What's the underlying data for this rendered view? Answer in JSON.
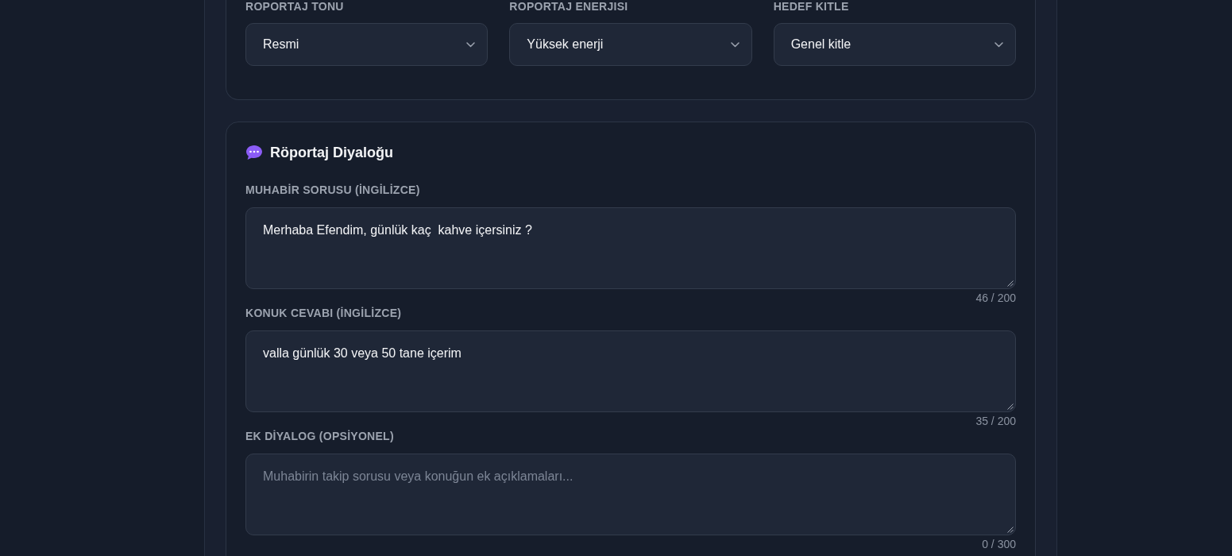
{
  "settings": [
    {
      "label": "ROPORTAJ TONU",
      "value": "Resmi"
    },
    {
      "label": "ROPORTAJ ENERJISI",
      "value": "Yüksek enerji"
    },
    {
      "label": "HEDEF KITLE",
      "value": "Genel kitle"
    }
  ],
  "dialog": {
    "title": "Röportaj Diyaloğu",
    "fields": [
      {
        "label": "MUHABİR SORUSU (İNGİLİZCE)",
        "value": "Merhaba Efendim, günlük kaç  kahve içersiniz ?",
        "counter": "46 / 200"
      },
      {
        "label": "KONUK CEVABI (İNGİLİZCE)",
        "value": "valla günlük 30 veya 50 tane içerim",
        "counter": "35 / 200"
      },
      {
        "label": "EK DİYALOG (OPSİYONEL)",
        "placeholder": "Muhabirin takip sorusu veya konuğun ek açıklamaları...",
        "counter": "0 / 300"
      }
    ]
  }
}
